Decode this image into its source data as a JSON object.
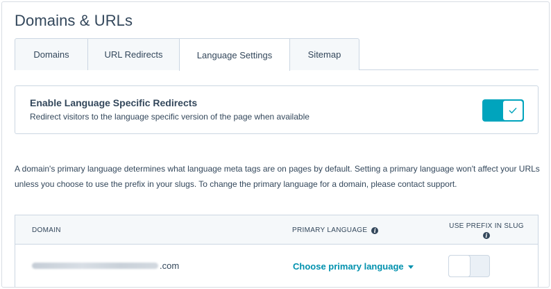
{
  "page": {
    "title": "Domains & URLs"
  },
  "tabs": [
    {
      "label": "Domains",
      "active": false
    },
    {
      "label": "URL Redirects",
      "active": false
    },
    {
      "label": "Language Settings",
      "active": true
    },
    {
      "label": "Sitemap",
      "active": false
    }
  ],
  "redirect_setting": {
    "title": "Enable Language Specific Redirects",
    "description": "Redirect visitors to the language specific version of the page when available",
    "enabled": true,
    "icon": "check-icon"
  },
  "info_text": "A domain's primary language determines what language meta tags are on pages by default. Setting a primary language won't affect your URLs unless you choose to use the prefix in your slugs. To change the primary language for a domain, please contact support.",
  "table": {
    "columns": {
      "domain": "DOMAIN",
      "primary_language": "PRIMARY LANGUAGE",
      "use_prefix": "USE PREFIX IN SLUG"
    },
    "rows": [
      {
        "domain_suffix": ".com",
        "primary_language_action": "Choose primary language",
        "use_prefix": false
      }
    ]
  },
  "colors": {
    "accent": "#00a4bd",
    "link": "#0091ae",
    "text": "#33475b",
    "border": "#cbd6e2",
    "header_bg": "#f5f8fa"
  }
}
